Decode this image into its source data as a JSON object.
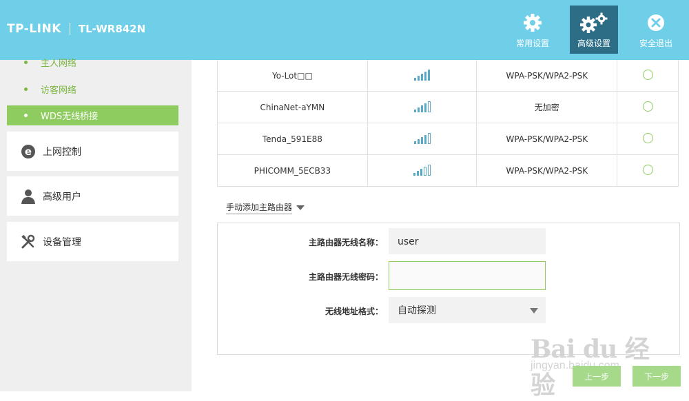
{
  "header": {
    "brand": "TP-LINK",
    "model": "TL-WR842N",
    "nav": [
      {
        "label": "常用设置",
        "icon": "gear-icon"
      },
      {
        "label": "高级设置",
        "icon": "gears-icon",
        "active": true
      },
      {
        "label": "安全退出",
        "icon": "close-icon"
      }
    ]
  },
  "sidebar": {
    "sub_items": [
      {
        "label": "主人网络"
      },
      {
        "label": "访客网络"
      },
      {
        "label": "WDS无线桥接",
        "active": true
      }
    ],
    "menus": [
      {
        "label": "上网控制",
        "icon": "ie-icon"
      },
      {
        "label": "高级用户",
        "icon": "user-icon"
      },
      {
        "label": "设备管理",
        "icon": "tools-icon"
      }
    ]
  },
  "networks": [
    {
      "ssid": "Yo-Lot□□",
      "signal": 5,
      "security": "WPA-PSK/WPA2-PSK"
    },
    {
      "ssid": "ChinaNet-aYMN",
      "signal": 4,
      "security": "无加密"
    },
    {
      "ssid": "Tenda_591E88",
      "signal": 4,
      "security": "WPA-PSK/WPA2-PSK"
    },
    {
      "ssid": "PHICOMM_5ECB33",
      "signal": 3,
      "security": "WPA-PSK/WPA2-PSK"
    }
  ],
  "manual": {
    "link_label": "手动添加主路由器"
  },
  "form": {
    "ssid_label": "主路由器无线名称：",
    "ssid_value": "user",
    "password_label": "主路由器无线密码：",
    "password_value": "",
    "mode_label": "无线地址格式：",
    "mode_value": "自动探测"
  },
  "buttons": {
    "prev": "上一步",
    "next": "下一步"
  },
  "watermark": {
    "line1": "Bai du 经验",
    "line2": "jingyan.baidu.com"
  },
  "colors": {
    "header": "#6fcfe8",
    "nav_active": "#2d6d86",
    "accent_green": "#8fcc5f",
    "button_green": "#a6d98a"
  }
}
